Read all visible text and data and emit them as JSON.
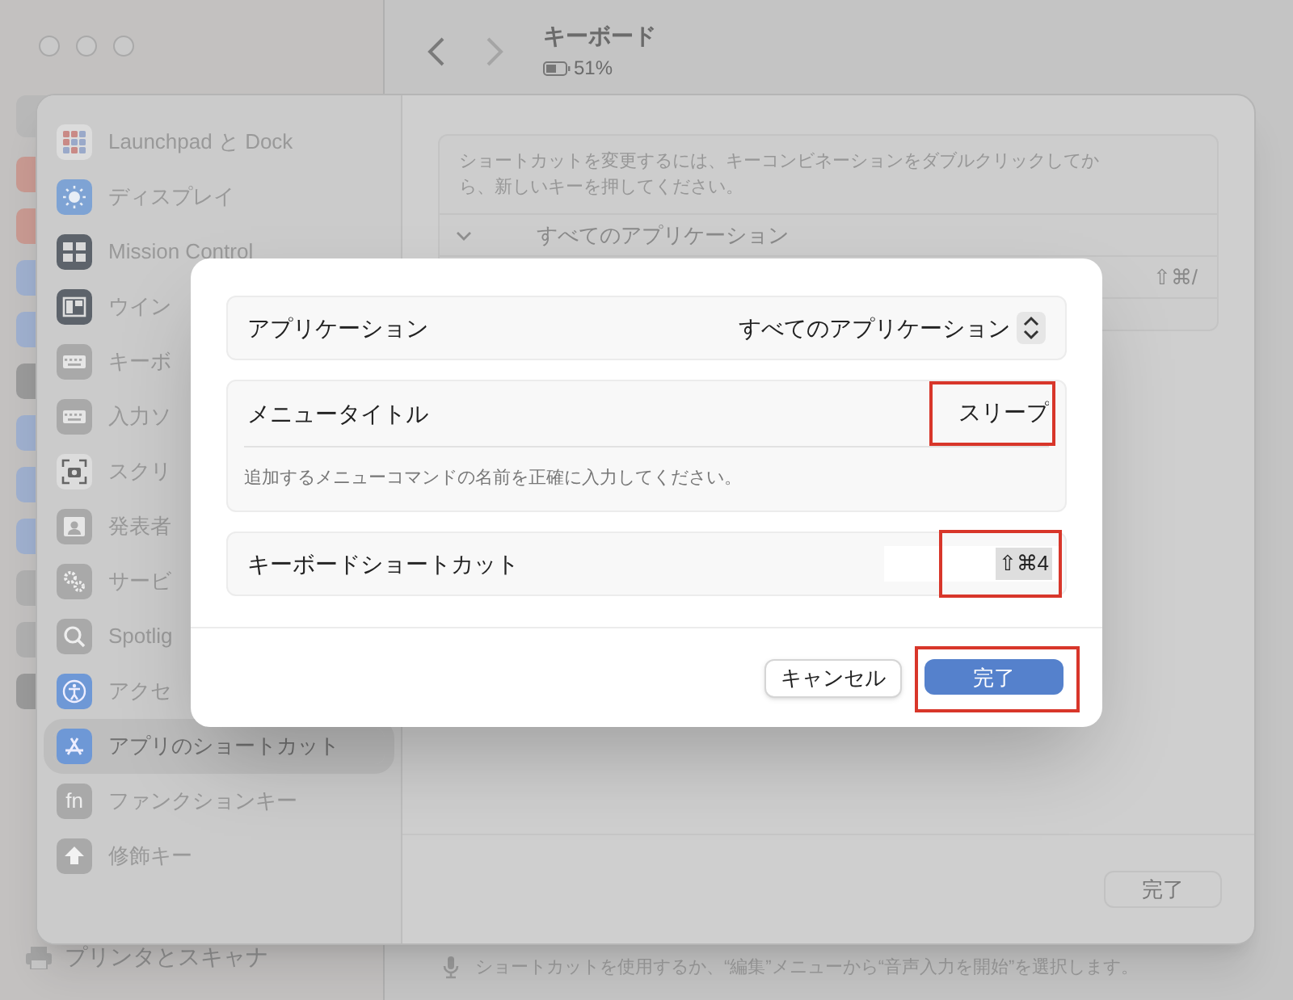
{
  "back_window": {
    "title": "キーボード",
    "battery": "51%",
    "bottom_item": "プリンタとスキャナ",
    "hint": "ショートカットを使用するか、“編集”メニューから“音声入力を開始”を選択します。"
  },
  "sheet": {
    "sidebar": [
      {
        "label": "Launchpad と Dock",
        "selected": false
      },
      {
        "label": "ディスプレイ",
        "selected": false
      },
      {
        "label": "Mission Control",
        "selected": false
      },
      {
        "label": "ウイン",
        "selected": false
      },
      {
        "label": "キーボ",
        "selected": false
      },
      {
        "label": "入力ソ",
        "selected": false
      },
      {
        "label": "スクリ",
        "selected": false
      },
      {
        "label": "発表者",
        "selected": false
      },
      {
        "label": "サービ",
        "selected": false
      },
      {
        "label": "Spotlig",
        "selected": false
      },
      {
        "label": "アクセ",
        "selected": false
      },
      {
        "label": "アプリのショートカット",
        "selected": true
      },
      {
        "label": "ファンクションキー",
        "icon_text": "fn",
        "selected": false
      },
      {
        "label": "修飾キー",
        "selected": false
      }
    ],
    "description": "ショートカットを変更するには、キーコンビネーションをダブルクリックしてから、新しいキーを押してください。",
    "group": {
      "label": "すべてのアプリケーション",
      "expanded": true
    },
    "shortcut": "⇧⌘/",
    "done_button": "完了"
  },
  "dialog": {
    "application": {
      "label": "アプリケーション",
      "value": "すべてのアプリケーション"
    },
    "menu_title": {
      "label": "メニュータイトル",
      "value": "スリープ",
      "hint": "追加するメニューコマンドの名前を正確に入力してください。",
      "annotated": true
    },
    "shortcut": {
      "label": "キーボードショートカット",
      "value": "⇧⌘4",
      "annotated": true
    },
    "buttons": [
      {
        "label": "キャンセル",
        "kind": "secondary",
        "annotated": false
      },
      {
        "label": "完了",
        "kind": "primary",
        "annotated": true
      }
    ]
  }
}
